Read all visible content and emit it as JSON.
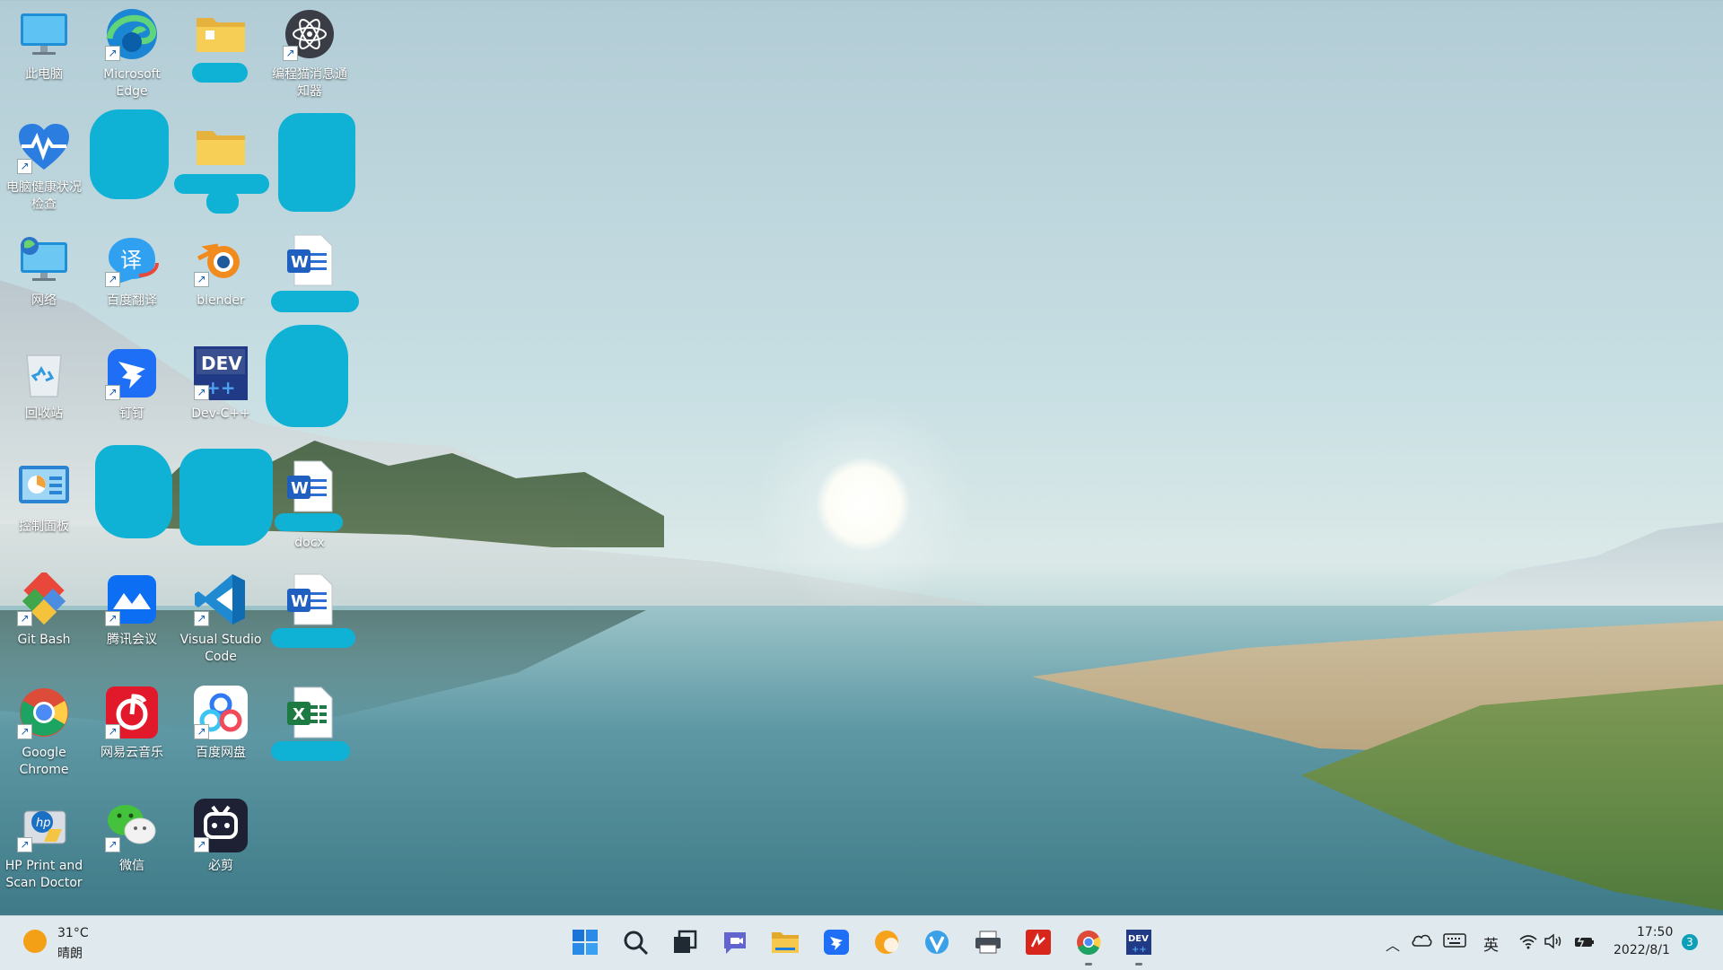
{
  "desktop": {
    "icons": [
      {
        "id": "this-pc",
        "label": "此电脑"
      },
      {
        "id": "edge",
        "label": "Microsoft\nEdge"
      },
      {
        "id": "folder-1",
        "label": ""
      },
      {
        "id": "bianchengmao",
        "label": "编程猫消息通\n知器"
      },
      {
        "id": "health-check",
        "label": "电脑健康状况\n检查"
      },
      {
        "id": "network",
        "label": "网络"
      },
      {
        "id": "baidu-translate",
        "label": "百度翻译"
      },
      {
        "id": "blender",
        "label": "blender"
      },
      {
        "id": "recycle",
        "label": "回收站"
      },
      {
        "id": "dingtalk",
        "label": "钉钉"
      },
      {
        "id": "devcpp",
        "label": "Dev-C++"
      },
      {
        "id": "control-panel",
        "label": "控制面板"
      },
      {
        "id": "word-docx",
        "label": "docx"
      },
      {
        "id": "git-bash",
        "label": "Git Bash"
      },
      {
        "id": "tencent-meeting",
        "label": "腾讯会议"
      },
      {
        "id": "vscode",
        "label": "Visual Studio\nCode"
      },
      {
        "id": "chrome",
        "label": "Google\nChrome"
      },
      {
        "id": "netease-music",
        "label": "网易云音乐"
      },
      {
        "id": "baidu-netdisk",
        "label": "百度网盘"
      },
      {
        "id": "hp-print",
        "label": "HP Print and\nScan Doctor"
      },
      {
        "id": "wechat",
        "label": "微信"
      },
      {
        "id": "bijian",
        "label": "必剪"
      }
    ]
  },
  "taskbar": {
    "weather": {
      "temp": "31°C",
      "desc": "晴朗"
    },
    "ime": "英",
    "time": "17:50",
    "date": "2022/8/1",
    "notification_count": "3"
  },
  "colors": {
    "redaction": "#0fb2d4",
    "taskbar_bg": "#dfe9ee"
  }
}
